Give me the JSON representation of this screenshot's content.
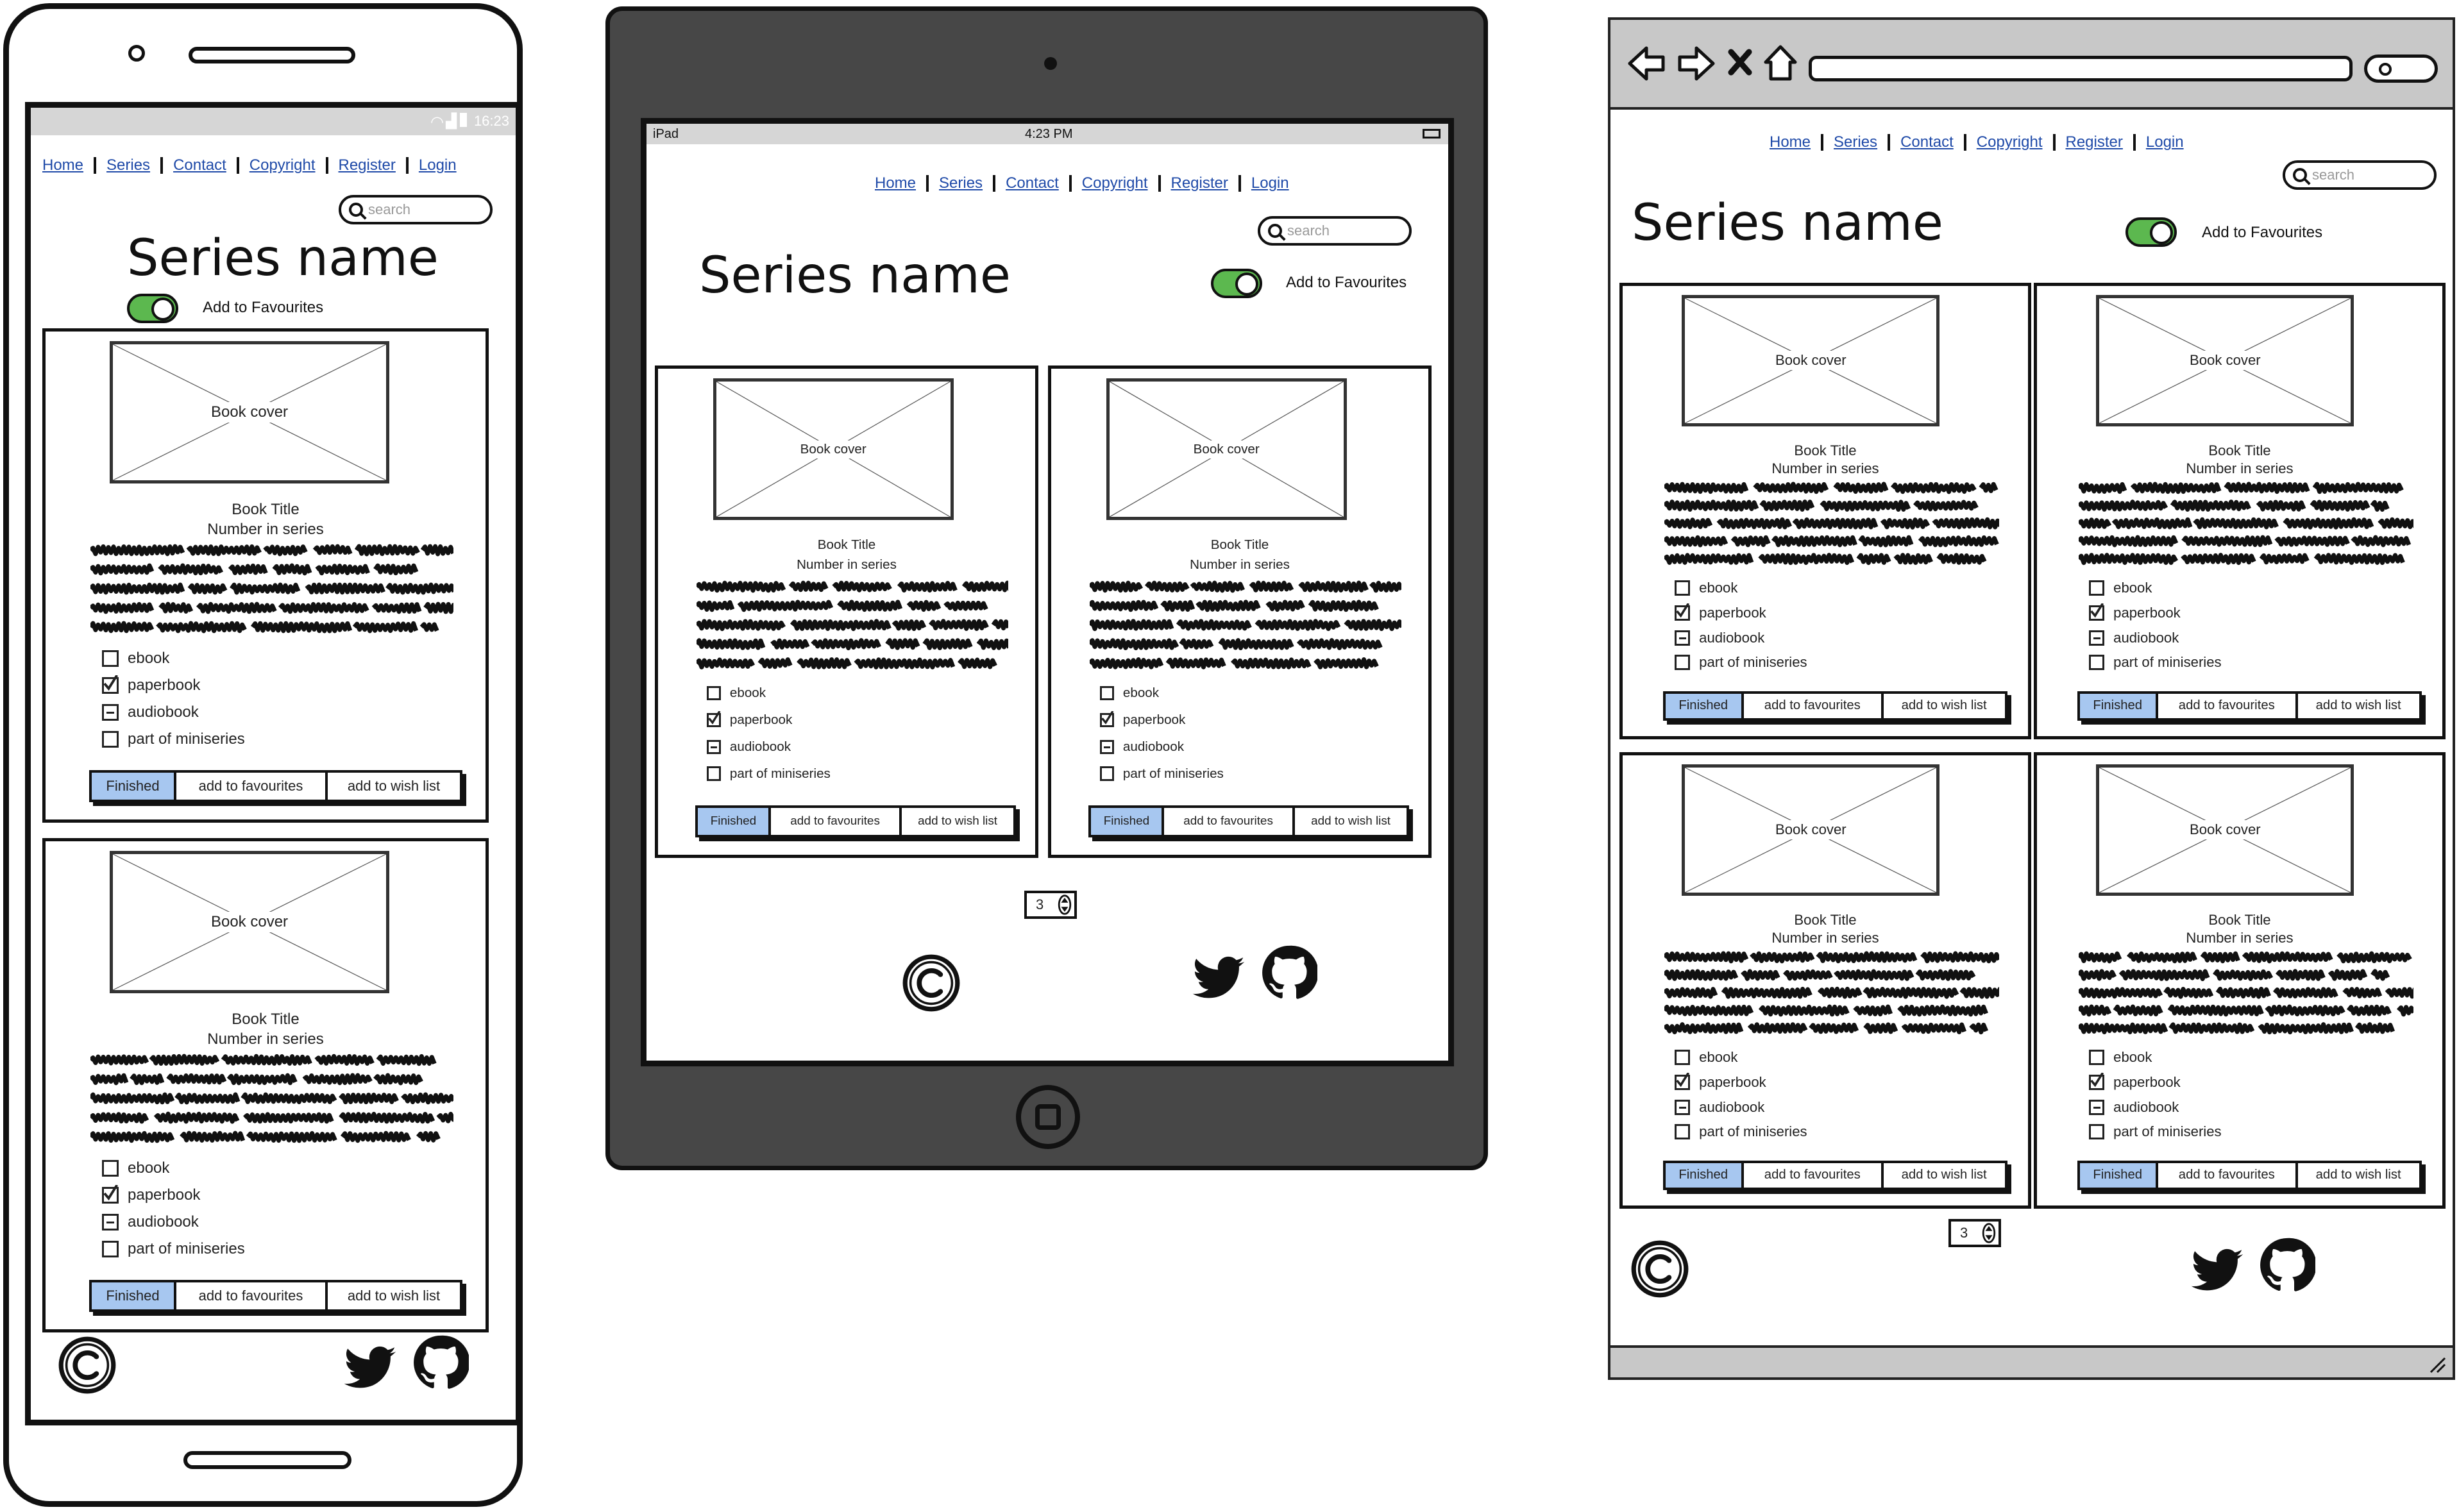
{
  "nav": [
    "Home",
    "Series",
    "Contact",
    "Copyright",
    "Register",
    "Login"
  ],
  "search_placeholder": "search",
  "page_title": "Series name",
  "favourites_label": "Add to Favourites",
  "card": {
    "cover_label": "Book cover",
    "book_title": "Book Title",
    "number_in_series": "Number in series",
    "checkboxes": [
      {
        "label": "ebook",
        "state": "unchecked"
      },
      {
        "label": "paperbook",
        "state": "checked"
      },
      {
        "label": "audiobook",
        "state": "indeterminate"
      },
      {
        "label": "part of miniseries",
        "state": "unchecked"
      }
    ],
    "buttons": [
      "Finished",
      "add to favourites",
      "add to wish list"
    ]
  },
  "pagination_value": "3",
  "phone_status_time": "16:23",
  "tablet_status": {
    "device": "iPad",
    "time": "4:23 PM"
  },
  "colors": {
    "toggle_on": "#5cb84f",
    "primary_button": "#a7c7f0",
    "link": "#1f4aa8",
    "tablet_frame": "#474747",
    "chrome_bar": "#c8c8c8"
  },
  "icons": [
    "copyright-icon",
    "twitter-icon",
    "github-icon",
    "search-icon",
    "back-arrow-icon",
    "forward-arrow-icon",
    "close-icon",
    "home-icon",
    "stepper-icon",
    "resize-grip-icon",
    "wifi-icon",
    "battery-icon",
    "signal-icon",
    "camera-icon",
    "home-button-icon"
  ]
}
